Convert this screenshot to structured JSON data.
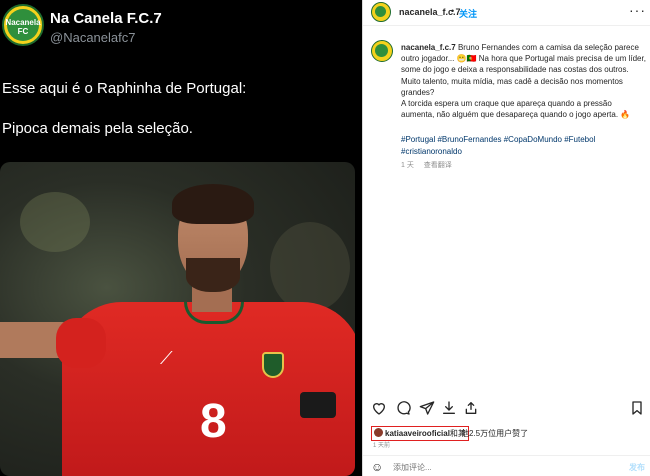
{
  "tweet": {
    "display_name": "Na Canela F.C.7",
    "handle": "@Nacanelafc7",
    "avatar_text": "Nacanela FC",
    "line1": "Esse aqui é o Raphinha de Portugal:",
    "line2": "Pipoca demais pela seleção.",
    "jersey_number": "8"
  },
  "instagram": {
    "header": {
      "username": "nacanela_f.c.7",
      "separator": "•",
      "follow_label": "关注",
      "more_icon": "more-dots-icon"
    },
    "caption": {
      "username": "nacanela_f.c.7",
      "text": "Bruno Fernandes com a camisa da seleção parece outro jogador... 😬🇵🇹 Na hora que Portugal mais precisa de um líder, some do jogo e deixa a responsabilidade nas costas dos outros. Muito talento, muita mídia, mas cadê a decisão nos momentos grandes?",
      "text2": "A torcida espera um craque que apareça quando a pressão aumenta, não alguém que desapareça quando o jogo aperta. 🔥",
      "hashtags": "#Portugal #BrunoFernandes #CopaDoMundo #Futebol #cristianoronaldo",
      "time": "1 天",
      "translation": "查看翻译"
    },
    "actions": [
      "heart-icon",
      "comment-icon",
      "share-icon",
      "download-icon",
      "link-icon",
      "bookmark-icon"
    ],
    "likes": {
      "user": "katiaaveirooficial",
      "and": "和其",
      "rest": "他2.5万位用户赞了"
    },
    "time_ago": "1 天前",
    "comment": {
      "placeholder": "添加评论...",
      "post_label": "发布",
      "emoji_icon": "smiley-icon"
    }
  }
}
